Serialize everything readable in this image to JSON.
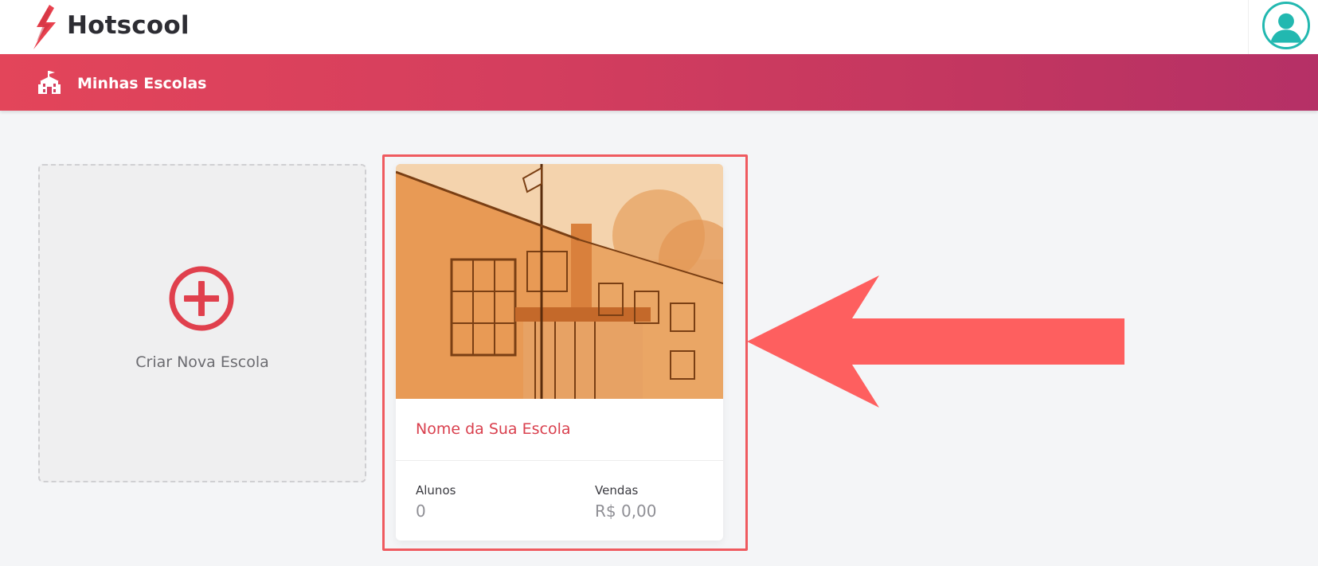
{
  "header": {
    "app_name": "Hotscool",
    "logo_icon": "lightning-bolt-icon",
    "avatar_icon": "user-avatar-icon",
    "accent_color": "#e0404d"
  },
  "banner": {
    "icon": "school-building-icon",
    "title": "Minhas Escolas",
    "gradient_start": "#e3455a",
    "gradient_end": "#b53066"
  },
  "new_school": {
    "icon": "plus-circle-icon",
    "label": "Criar Nova Escola"
  },
  "school_card": {
    "image": "school-building-illustration",
    "name": "Nome da Sua Escola",
    "stats": [
      {
        "label": "Alunos",
        "value": "0"
      },
      {
        "label": "Vendas",
        "value": "R$ 0,00"
      }
    ]
  },
  "annotation": {
    "highlight_color": "#ef5a5f",
    "arrow_icon": "left-arrow-icon"
  }
}
